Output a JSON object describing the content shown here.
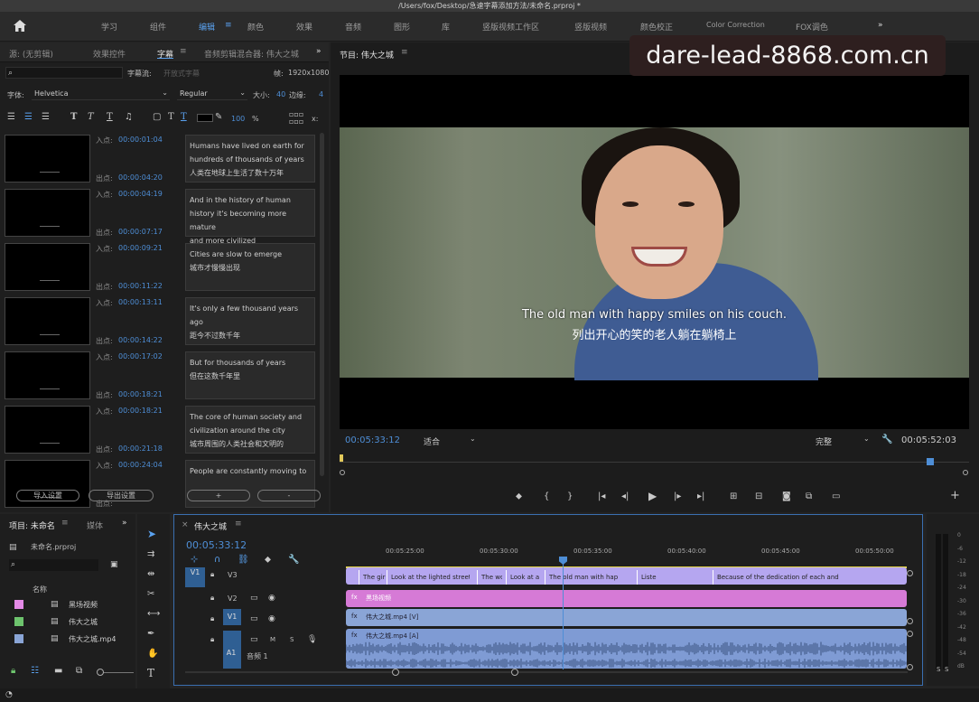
{
  "window": {
    "title": "/Users/fox/Desktop/急速字幕添加方法/未命名.prproj *"
  },
  "workspaces": {
    "learn": "学习",
    "assemble": "组件",
    "edit": "编辑",
    "color": "颜色",
    "effects": "效果",
    "audio": "音频",
    "graphics": "图形",
    "library": "库",
    "vertical_ws": "竖版视频工作区",
    "vertical": "竖版视频",
    "color_correct": "颜色校正",
    "color_correction": "Color Correction",
    "fox_color": "FOX调色",
    "more": "»"
  },
  "watermark": "dare-lead-8868.com.cn",
  "left_panel": {
    "tabs": {
      "source": "源: (无剪辑)",
      "effect_controls": "效果控件",
      "captions": "字幕",
      "audio_mixer": "音频剪辑混合器: 伟大之城",
      "more": "»"
    },
    "stream_label": "字幕流:",
    "stream_value": "开放式字幕",
    "frame_label": "帧:",
    "frame_value": "1920x1080",
    "font_label": "字体:",
    "font_value": "Helvetica",
    "style_value": "Regular",
    "size_label": "大小:",
    "size_value": "40",
    "edge_label": "边缘:",
    "edge_value": "4",
    "opacity_value": "100",
    "opacity_unit": "%",
    "x_label": "x:",
    "in_label": "入点:",
    "out_label": "出点:",
    "captions": [
      {
        "in": "00:00:01:04",
        "out": "00:00:04:20",
        "lines": [
          "Humans have lived on earth for",
          "hundreds of thousands of years",
          "人类在地球上生活了数十万年"
        ]
      },
      {
        "in": "00:00:04:19",
        "out": "00:00:07:17",
        "lines": [
          "And in the history of human",
          "history it's becoming more mature",
          "and more civilized"
        ]
      },
      {
        "in": "00:00:09:21",
        "out": "00:00:11:22",
        "lines": [
          "Cities are slow to emerge",
          "城市才慢慢出现"
        ]
      },
      {
        "in": "00:00:13:11",
        "out": "00:00:14:22",
        "lines": [
          "It's only a few thousand years ago",
          "距今不过数千年"
        ]
      },
      {
        "in": "00:00:17:02",
        "out": "00:00:18:21",
        "lines": [
          "But for thousands of years",
          "但在这数千年里"
        ]
      },
      {
        "in": "00:00:18:21",
        "out": "00:00:21:18",
        "lines": [
          "The core of human society and",
          "civilization around the city",
          "城市周围的人类社会和文明的"
        ]
      },
      {
        "in": "00:00:24:04",
        "out": "",
        "lines": [
          "People are constantly moving to"
        ]
      }
    ],
    "import_btn": "导入设置",
    "export_btn": "导出设置",
    "add_btn": "+",
    "remove_btn": "-"
  },
  "program": {
    "title": "节目: 伟大之城",
    "subtitle_en": "The old man with happy smiles on his couch.",
    "subtitle_zh": "列出开心的笑的老人躺在躺椅上",
    "timecode": "00:05:33:12",
    "fit": "适合",
    "quality": "完整",
    "duration": "00:05:52:03"
  },
  "project": {
    "tab": "项目: 未命名",
    "media_tab": "媒体",
    "more": "»",
    "file": "未命名.prproj",
    "name_col": "名称",
    "items": [
      {
        "name": "黑场视频",
        "color": "#e48ae6"
      },
      {
        "name": "伟大之城",
        "color": "#6dc36d"
      },
      {
        "name": "伟大之城.mp4",
        "color": "#8aa5d6"
      }
    ]
  },
  "timeline": {
    "tab": "伟大之城",
    "timecode": "00:05:33:12",
    "ruler": [
      "00:05:25:00",
      "00:05:30:00",
      "00:05:35:00",
      "00:05:40:00",
      "00:05:45:00",
      "00:05:50:00"
    ],
    "tracks": {
      "v3": "V3",
      "v2": "V2",
      "v1": "V1",
      "a1": "A1",
      "audio_name": "音频 1",
      "m": "M",
      "s": "S"
    },
    "src_v1": "V1",
    "src_a1": "A1",
    "captions": [
      "The girl",
      "Look at the lighted street in a",
      "The wo",
      "Look at a",
      "The old man with hap",
      "Liste",
      "Because of the dedication of each and the"
    ],
    "black_clip": "黑场视频",
    "video_clip": "伟大之城.mp4 [V]",
    "audio_clip": "伟大之城.mp4 [A]"
  },
  "meter": {
    "labels": [
      "0",
      "-6",
      "-12",
      "-18",
      "-24",
      "-30",
      "-36",
      "-42",
      "-48",
      "-54",
      "dB"
    ],
    "solo": "S",
    "solo2": "S"
  },
  "colors": {
    "accent": "#5aa2f0",
    "timecode": "#4e8ed6",
    "caption_track": "#b5a6f0",
    "black_clip": "#d67ad6",
    "video_clip": "#8aa5d6",
    "audio_clip": "#7f9bd4"
  }
}
